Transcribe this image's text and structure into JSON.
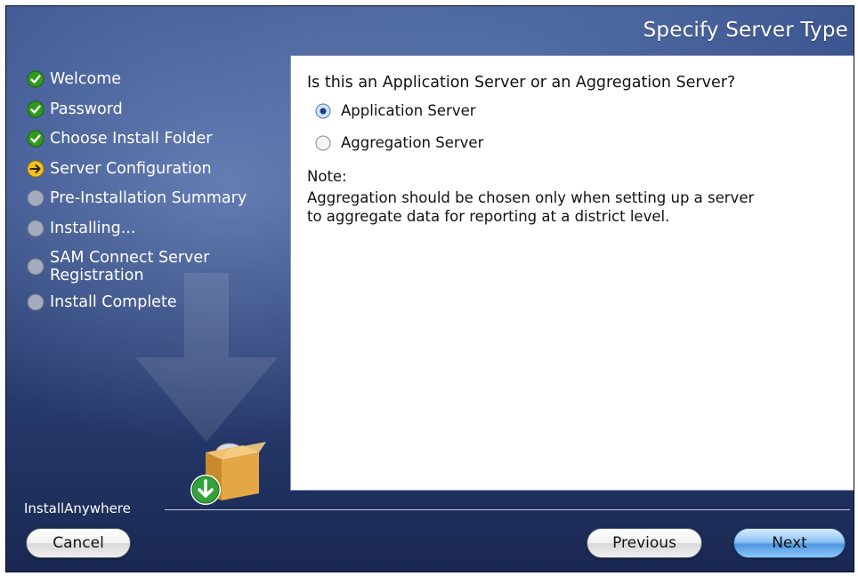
{
  "header": {
    "title": "Specify Server Type"
  },
  "steps": [
    {
      "label": "Welcome",
      "status": "complete"
    },
    {
      "label": "Password",
      "status": "complete"
    },
    {
      "label": "Choose Install Folder",
      "status": "complete"
    },
    {
      "label": "Server Configuration",
      "status": "current"
    },
    {
      "label": "Pre-Installation Summary",
      "status": "pending"
    },
    {
      "label": "Installing...",
      "status": "pending"
    },
    {
      "label_line1": "SAM Connect Server",
      "label_line2": "Registration",
      "status": "pending"
    },
    {
      "label": "Install Complete",
      "status": "pending"
    }
  ],
  "content": {
    "question": "Is this an Application Server or an Aggregation Server?",
    "options": [
      {
        "label": "Application Server",
        "selected": true
      },
      {
        "label": "Aggregation Server",
        "selected": false
      }
    ],
    "note_label": "Note:",
    "note_line1": "Aggregation should be chosen only when setting up a server",
    "note_line2": "to aggregate data for reporting at a district level."
  },
  "footer": {
    "brand": "InstallAnywhere"
  },
  "buttons": {
    "cancel": "Cancel",
    "previous": "Previous",
    "next": "Next"
  },
  "colors": {
    "complete": "#2f9a1c",
    "current": "#f2c21a",
    "pending": "#9aa3b5",
    "radio_selected": "#2f6fd6",
    "next_button": "#6fb1f0"
  },
  "icons": {
    "complete": "check-circle-icon",
    "current": "arrow-right-circle-icon",
    "pending": "empty-circle-icon"
  }
}
